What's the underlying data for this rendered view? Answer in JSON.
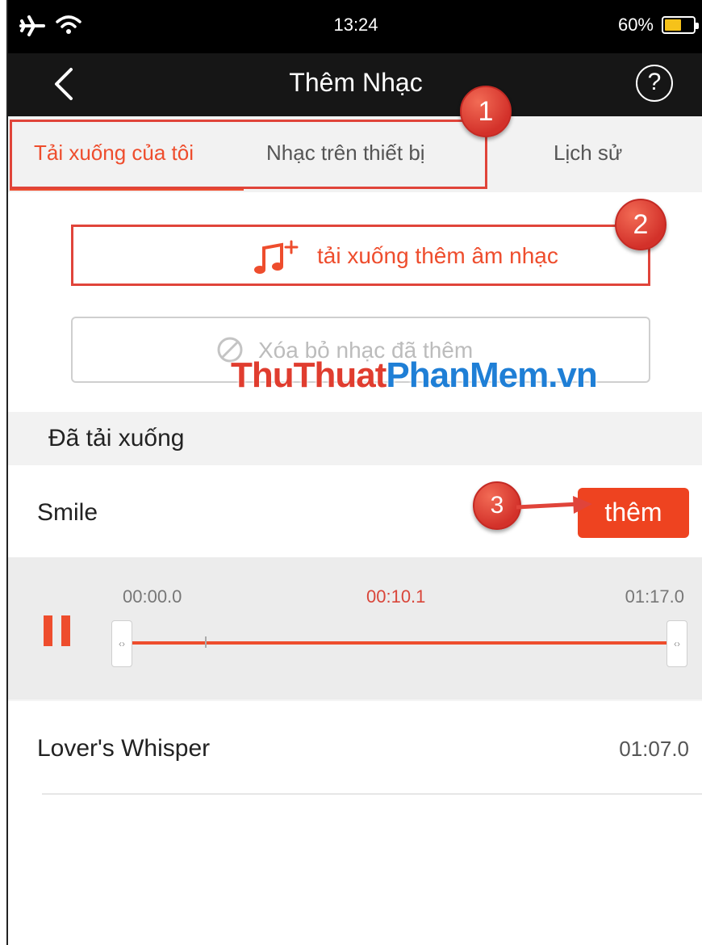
{
  "status_bar": {
    "time": "13:24",
    "battery_percent": "60%",
    "battery_level": 0.6,
    "icons": [
      "airplane-mode-icon",
      "wifi-icon",
      "battery-icon"
    ]
  },
  "nav_bar": {
    "title": "Thêm Nhạc",
    "back_icon": "chevron-left-icon",
    "help_label": "?"
  },
  "tabs": [
    {
      "label": "Tải xuống của tôi",
      "active": true
    },
    {
      "label": "Nhạc trên thiết bị",
      "active": false
    },
    {
      "label": "Lịch sử",
      "active": false
    }
  ],
  "actions": {
    "download_more_label": "tải xuống thêm âm nhạc",
    "download_more_icon": "music-note-plus-icon",
    "remove_added_label": "Xóa bỏ nhạc đã thêm",
    "remove_added_icon": "forbidden-icon"
  },
  "watermark": {
    "part_a": "ThuThuat",
    "part_b": "PhanMem.vn"
  },
  "section": {
    "title": "Đã tải xuống"
  },
  "tracks": [
    {
      "title": "Smile",
      "add_label": "thêm",
      "player": {
        "start": "00:00.0",
        "current": "00:10.1",
        "end": "01:17.0"
      }
    },
    {
      "title": "Lover's Whisper",
      "duration": "01:07.0"
    }
  ],
  "annotations": [
    "1",
    "2",
    "3"
  ],
  "colors": {
    "accent": "#ee4d2d",
    "annotation_red": "#e0443a",
    "nav_bg": "#161616"
  }
}
